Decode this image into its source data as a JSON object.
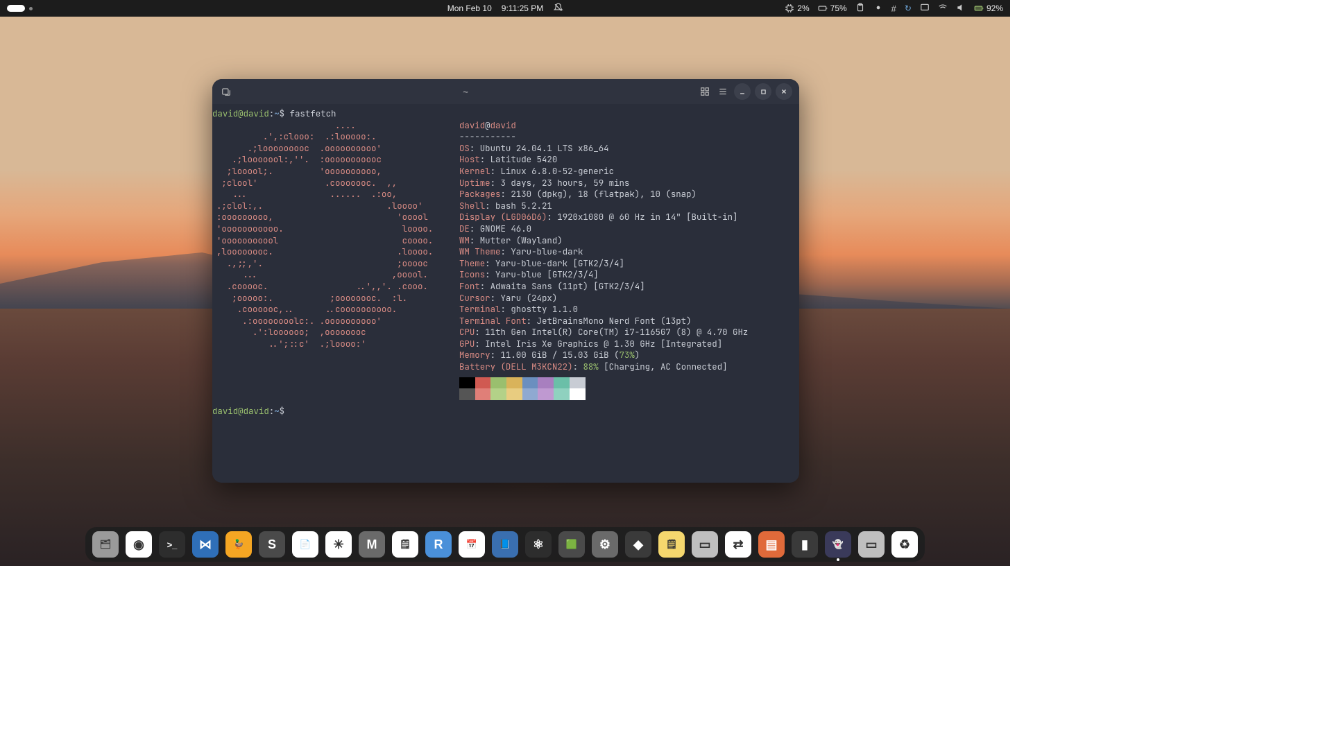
{
  "topbar": {
    "date": "Mon Feb 10",
    "time": "9:11:25 PM",
    "cpu_pct": "2%",
    "net_pct": "75%",
    "battery_icon_pct": "92%"
  },
  "terminal": {
    "title": "~",
    "prompt1_user": "david@david",
    "prompt1_path": "~",
    "prompt1_cmd": "fastfetch",
    "prompt2_user": "david@david",
    "prompt2_path": "~",
    "ascii": [
      "                       ....               ",
      "         .',:clooo:  .:looooo:.           ",
      "      .;looooooooc  .oooooooooo'          ",
      "   .;looooool:,''.  :ooooooooooc          ",
      "  ;looool;.         'oooooooooo,          ",
      " ;clool'             .cooooooc.  ,,       ",
      "   ...                ......  .:oo,       ",
      ".;clol:,.                        .loooo'  ",
      ":ooooooooo,                        'ooool ",
      "'ooooooooooo.                       loooo.",
      "'ooooooooool                        coooo.",
      ",loooooooc.                        .loooo.",
      "  .,;;,'.                          ;ooooc ",
      "     ...                          ,ooool. ",
      "  .cooooc.                 ..',,'. .cooo. ",
      "   ;ooooo:.           ;oooooooc.  :l.     ",
      "    .coooooc,..      ..coooooooooo.       ",
      "     .:oooooooolc:. .oooooooooo'          ",
      "       .':loooooo;  ,oooooooc             ",
      "          ..';::c'  .;loooo:'             "
    ],
    "header_user": "david",
    "header_at": "@",
    "header_host": "david",
    "dashes": "-----------",
    "info": [
      {
        "key": "OS",
        "val": "Ubuntu 24.04.1 LTS x86_64"
      },
      {
        "key": "Host",
        "val": "Latitude 5420"
      },
      {
        "key": "Kernel",
        "val": "Linux 6.8.0-52-generic"
      },
      {
        "key": "Uptime",
        "val": "3 days, 23 hours, 59 mins"
      },
      {
        "key": "Packages",
        "val": "2130 (dpkg), 18 (flatpak), 10 (snap)"
      },
      {
        "key": "Shell",
        "val": "bash 5.2.21"
      },
      {
        "key": "Display (LGD06D6)",
        "val": "1920x1080 @ 60 Hz in 14\" [Built-in]"
      },
      {
        "key": "DE",
        "val": "GNOME 46.0"
      },
      {
        "key": "WM",
        "val": "Mutter (Wayland)"
      },
      {
        "key": "WM Theme",
        "val": "Yaru-blue-dark"
      },
      {
        "key": "Theme",
        "val": "Yaru-blue-dark [GTK2/3/4]"
      },
      {
        "key": "Icons",
        "val": "Yaru-blue [GTK2/3/4]"
      },
      {
        "key": "Font",
        "val": "Adwaita Sans (11pt) [GTK2/3/4]"
      },
      {
        "key": "Cursor",
        "val": "Yaru (24px)"
      },
      {
        "key": "Terminal",
        "val": "ghostty 1.1.0"
      },
      {
        "key": "Terminal Font",
        "val": "JetBrainsMono Nerd Font (13pt)"
      },
      {
        "key": "CPU",
        "val": "11th Gen Intel(R) Core(TM) i7-1165G7 (8) @ 4.70 GHz"
      },
      {
        "key": "GPU",
        "val": "Intel Iris Xe Graphics @ 1.30 GHz [Integrated]"
      }
    ],
    "memory_key": "Memory",
    "memory_prefix": "11.00 GiB / 15.03 GiB (",
    "memory_pct": "73%",
    "memory_suffix": ")",
    "battery_key": "Battery (DELL M3KCN22)",
    "battery_pct": "88%",
    "battery_suffix": " [Charging, AC Connected]",
    "colorsA": [
      "#000000",
      "#d05a52",
      "#9abf6e",
      "#d9b35a",
      "#6b8fbf",
      "#a87fbf",
      "#6bbfa8",
      "#c8ccd4"
    ],
    "colorsB": [
      "#555555",
      "#e07f78",
      "#b3d188",
      "#e8cc80",
      "#8fa9d1",
      "#bf99d1",
      "#8fd1bf",
      "#ffffff"
    ]
  },
  "dock": [
    {
      "name": "files",
      "bg": "#9a9a9a",
      "glyph": "🗂"
    },
    {
      "name": "chrome",
      "bg": "#ffffff",
      "glyph": "◉"
    },
    {
      "name": "terminal",
      "bg": "#2d2d2d",
      "glyph": ">_"
    },
    {
      "name": "vscode",
      "bg": "#2f6fb8",
      "glyph": "⋈"
    },
    {
      "name": "duck",
      "bg": "#f5a623",
      "glyph": "🦆"
    },
    {
      "name": "sublime",
      "bg": "#4a4a4a",
      "glyph": "S"
    },
    {
      "name": "libre",
      "bg": "#ffffff",
      "glyph": "📄"
    },
    {
      "name": "wheel",
      "bg": "#ffffff",
      "glyph": "✳"
    },
    {
      "name": "mbox",
      "bg": "#6a6a6a",
      "glyph": "M"
    },
    {
      "name": "notes",
      "bg": "#ffffff",
      "glyph": "🗒"
    },
    {
      "name": "rstudio",
      "bg": "#4a90d9",
      "glyph": "R"
    },
    {
      "name": "calendar",
      "bg": "#ffffff",
      "glyph": "📅"
    },
    {
      "name": "bluedoc",
      "bg": "#3a6fb0",
      "glyph": "📘"
    },
    {
      "name": "atom",
      "bg": "#2d2d2d",
      "glyph": "⚛"
    },
    {
      "name": "greenapp",
      "bg": "#4a4a4a",
      "glyph": "🟩"
    },
    {
      "name": "settings",
      "bg": "#6a6a6a",
      "glyph": "⚙"
    },
    {
      "name": "obsidian",
      "bg": "#3a3a3a",
      "glyph": "◆"
    },
    {
      "name": "sticky",
      "bg": "#f5d76e",
      "glyph": "🗒"
    },
    {
      "name": "greydoc",
      "bg": "#bfbfbf",
      "glyph": "▭"
    },
    {
      "name": "switch",
      "bg": "#ffffff",
      "glyph": "⇄"
    },
    {
      "name": "orange",
      "bg": "#e06a3a",
      "glyph": "▤"
    },
    {
      "name": "yellowbar",
      "bg": "#3a3a3a",
      "glyph": "▮"
    },
    {
      "name": "ghostty",
      "bg": "#3a3a5a",
      "glyph": "👻",
      "active": true
    },
    {
      "name": "ssd",
      "bg": "#bfbfbf",
      "glyph": "▭"
    },
    {
      "name": "trash",
      "bg": "#ffffff",
      "glyph": "♻"
    }
  ]
}
